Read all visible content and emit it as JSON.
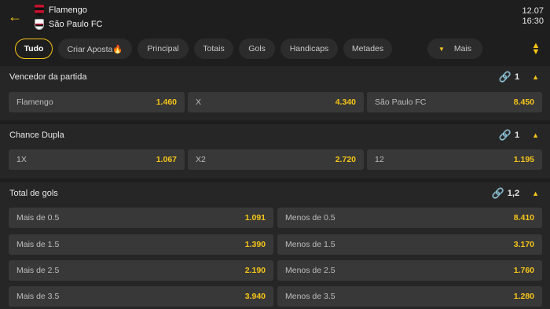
{
  "header": {
    "back_icon": "arrow-left-icon",
    "home_team": "Flamengo",
    "away_team": "São Paulo FC",
    "date": "12.07",
    "time": "16:30"
  },
  "tabs": [
    {
      "label": "Tudo",
      "active": true
    },
    {
      "label": "Criar Aposta🔥",
      "active": false
    },
    {
      "label": "Principal",
      "active": false
    },
    {
      "label": "Totais",
      "active": false
    },
    {
      "label": "Gols",
      "active": false
    },
    {
      "label": "Handicaps",
      "active": false
    },
    {
      "label": "Metades",
      "active": false
    },
    {
      "label": "Mais",
      "active": false
    }
  ],
  "sections": {
    "winner": {
      "title": "Vencedor da partida",
      "link_count": "1",
      "odds": [
        {
          "label": "Flamengo",
          "value": "1.460"
        },
        {
          "label": "X",
          "value": "4.340"
        },
        {
          "label": "São Paulo FC",
          "value": "8.450"
        }
      ]
    },
    "double_chance": {
      "title": "Chance Dupla",
      "link_count": "1",
      "odds": [
        {
          "label": "1X",
          "value": "1.067"
        },
        {
          "label": "X2",
          "value": "2.720"
        },
        {
          "label": "12",
          "value": "1.195"
        }
      ]
    },
    "total_goals": {
      "title": "Total de gols",
      "link_count": "1,2",
      "rows": [
        {
          "over": {
            "label": "Mais de 0.5",
            "value": "1.091"
          },
          "under": {
            "label": "Menos de 0.5",
            "value": "8.410"
          }
        },
        {
          "over": {
            "label": "Mais de 1.5",
            "value": "1.390"
          },
          "under": {
            "label": "Menos de 1.5",
            "value": "3.170"
          }
        },
        {
          "over": {
            "label": "Mais de 2.5",
            "value": "2.190"
          },
          "under": {
            "label": "Menos de 2.5",
            "value": "1.760"
          }
        },
        {
          "over": {
            "label": "Mais de 3.5",
            "value": "3.940"
          },
          "under": {
            "label": "Menos de 3.5",
            "value": "1.280"
          }
        }
      ]
    }
  },
  "colors": {
    "accent": "#f5c518",
    "background": "#1e1e1e",
    "cell": "#383838"
  }
}
